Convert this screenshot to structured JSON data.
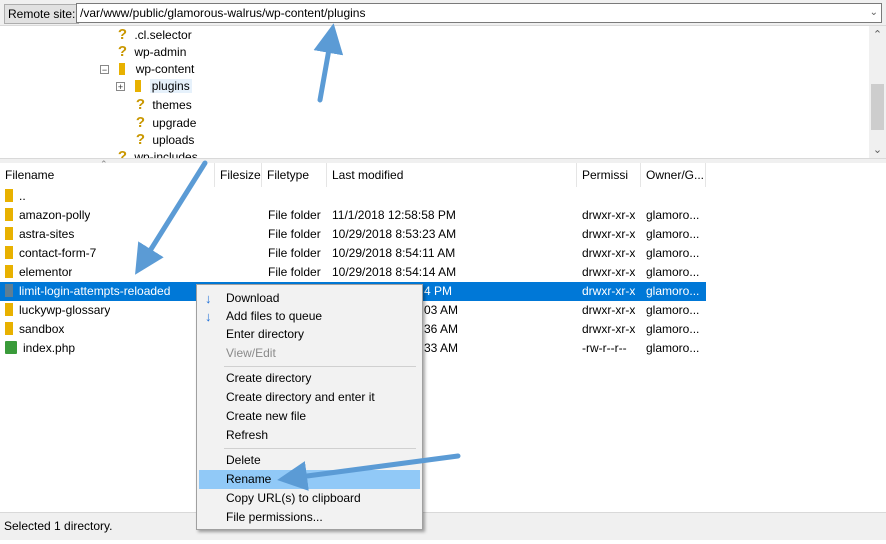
{
  "remote": {
    "label": "Remote site:",
    "path": "/var/www/public/glamorous-walrus/wp-content/plugins",
    "dropdown_glyph": "⌄"
  },
  "tree": {
    "items": [
      {
        "label": ".cl.selector",
        "icon": "question-folder-icon"
      },
      {
        "label": "wp-admin",
        "icon": "question-folder-icon"
      },
      {
        "label": "wp-content",
        "icon": "folder-icon",
        "expander": "−"
      },
      {
        "label": "plugins",
        "icon": "folder-icon",
        "expander": "+"
      },
      {
        "label": "themes",
        "icon": "question-folder-icon"
      },
      {
        "label": "upgrade",
        "icon": "question-folder-icon"
      },
      {
        "label": "uploads",
        "icon": "question-folder-icon"
      },
      {
        "label": "wp-includes",
        "icon": "question-folder-icon"
      }
    ]
  },
  "columns": [
    "Filename",
    "Filesize",
    "Filetype",
    "Last modified",
    "Permissi",
    "Owner/G..."
  ],
  "files": [
    {
      "name": "..",
      "size": "",
      "type": "",
      "modified": "",
      "perm": "",
      "owner": "",
      "icon": "folder-icon"
    },
    {
      "name": "amazon-polly",
      "size": "",
      "type": "File folder",
      "modified": "11/1/2018 12:58:58 PM",
      "perm": "drwxr-xr-x",
      "owner": "glamoro...",
      "icon": "folder-icon"
    },
    {
      "name": "astra-sites",
      "size": "",
      "type": "File folder",
      "modified": "10/29/2018 8:53:23 AM",
      "perm": "drwxr-xr-x",
      "owner": "glamoro...",
      "icon": "folder-icon"
    },
    {
      "name": "contact-form-7",
      "size": "",
      "type": "File folder",
      "modified": "10/29/2018 8:54:11 AM",
      "perm": "drwxr-xr-x",
      "owner": "glamoro...",
      "icon": "folder-icon"
    },
    {
      "name": "elementor",
      "size": "",
      "type": "File folder",
      "modified": "10/29/2018 8:54:14 AM",
      "perm": "drwxr-xr-x",
      "owner": "glamoro...",
      "icon": "folder-icon"
    },
    {
      "name": "limit-login-attempts-reloaded",
      "size": "",
      "type": "",
      "modified": "4 PM",
      "perm": "drwxr-xr-x",
      "owner": "glamoro...",
      "icon": "folder-icon",
      "selected": true
    },
    {
      "name": "luckywp-glossary",
      "size": "",
      "type": "",
      "modified": "03 AM",
      "perm": "drwxr-xr-x",
      "owner": "glamoro...",
      "icon": "folder-icon"
    },
    {
      "name": "sandbox",
      "size": "",
      "type": "",
      "modified": "36 AM",
      "perm": "drwxr-xr-x",
      "owner": "glamoro...",
      "icon": "folder-icon"
    },
    {
      "name": "index.php",
      "size": "",
      "type": "",
      "modified": "33 AM",
      "perm": "-rw-r--r--",
      "owner": "glamoro...",
      "icon": "php-file-icon"
    }
  ],
  "status": "Selected 1 directory.",
  "context_menu": {
    "items": [
      {
        "label": "Download",
        "icon": "download-icon"
      },
      {
        "label": "Add files to queue",
        "icon": "add-to-queue-icon"
      },
      {
        "label": "Enter directory"
      },
      {
        "label": "View/Edit",
        "disabled": true
      },
      {
        "separator": true
      },
      {
        "label": "Create directory"
      },
      {
        "label": "Create directory and enter it"
      },
      {
        "label": "Create new file"
      },
      {
        "label": "Refresh"
      },
      {
        "separator": true
      },
      {
        "label": "Delete"
      },
      {
        "label": "Rename",
        "highlighted": true
      },
      {
        "label": "Copy URL(s) to clipboard"
      },
      {
        "label": "File permissions..."
      }
    ]
  },
  "colors": {
    "selection": "#0078d7",
    "menu_hover": "#91c9f7",
    "annotation_arrow": "#5b9bd5",
    "folder": "#e8b100"
  }
}
